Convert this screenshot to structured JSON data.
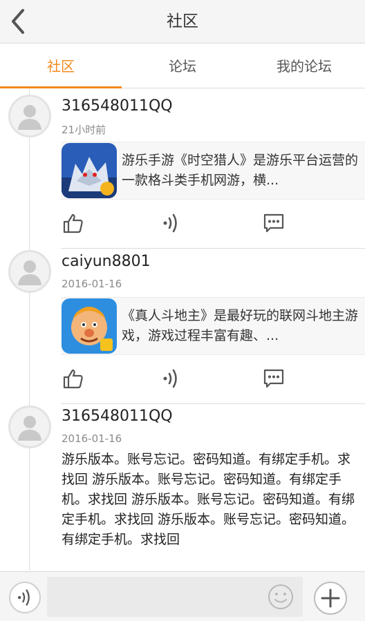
{
  "header": {
    "title": "社区",
    "back_icon": "chevron-left-icon"
  },
  "tabs": [
    {
      "label": "社区",
      "active": true
    },
    {
      "label": "论坛",
      "active": false
    },
    {
      "label": "我的论坛",
      "active": false
    }
  ],
  "posts": [
    {
      "username": "316548011QQ",
      "time": "21小时前",
      "share": {
        "text": "游乐手游《时空猎人》是游乐平台运营的一款格斗类手机网游，横...",
        "icon": "wolf-game-icon"
      }
    },
    {
      "username": "caiyun8801",
      "time": "2016-01-16",
      "share": {
        "text": "《真人斗地主》是最好玩的联网斗地主游戏，游戏过程丰富有趣、...",
        "icon": "landlord-game-icon"
      }
    },
    {
      "username": "316548011QQ",
      "time": "2016-01-16",
      "body": "游乐版本。账号忘记。密码知道。有绑定手机。求找回 游乐版本。账号忘记。密码知道。有绑定手机。求找回 游乐版本。账号忘记。密码知道。有绑定手机。求找回 游乐版本。账号忘记。密码知道。有绑定手机。求找回"
    }
  ],
  "colors": {
    "accent": "#f28a1c",
    "divider": "#dcdcdc"
  }
}
